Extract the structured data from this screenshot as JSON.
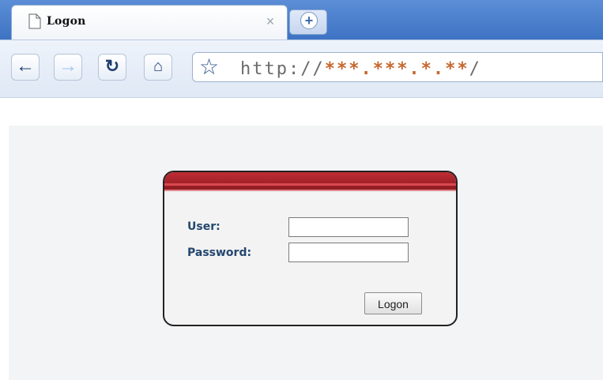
{
  "browser": {
    "tab": {
      "title": "Logon",
      "close_glyph": "×",
      "page_icon": "document-icon"
    },
    "new_tab": {
      "icon": "plus-icon",
      "glyph": "+"
    },
    "toolbar": {
      "back_icon": "back-arrow-icon",
      "forward_icon": "forward-arrow-icon",
      "reload_icon": "reload-icon",
      "home_icon": "home-icon",
      "star_icon": "star-icon"
    },
    "address_bar": {
      "prefix": "http://",
      "masked_host": "***.***.*.**",
      "suffix": "/"
    }
  },
  "login_form": {
    "user_label": "User:",
    "password_label": "Password:",
    "user_value": "",
    "password_value": "",
    "submit_label": "Logon"
  },
  "colors": {
    "header_red": "#b92a32",
    "label_blue": "#24476e",
    "page_bg": "#f2f4f5",
    "url_mask": "#c6672f"
  }
}
